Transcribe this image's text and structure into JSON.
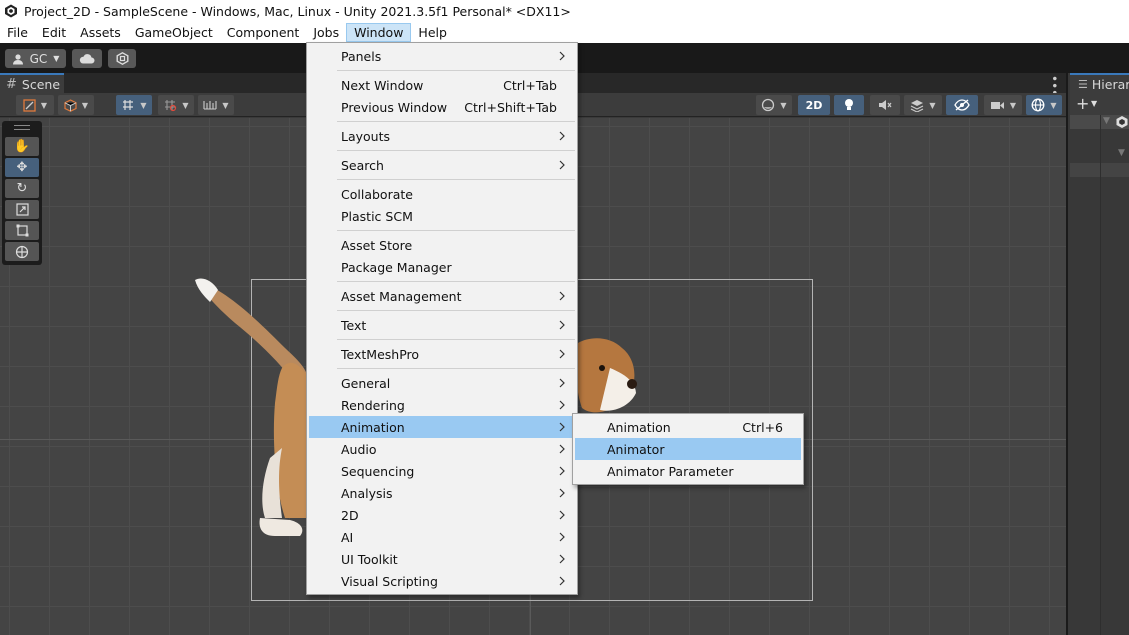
{
  "window": {
    "title": "Project_2D - SampleScene - Windows, Mac, Linux - Unity 2021.3.5f1 Personal* <DX11>"
  },
  "menubar": {
    "items": [
      "File",
      "Edit",
      "Assets",
      "GameObject",
      "Component",
      "Jobs",
      "Window",
      "Help"
    ],
    "active": "Window"
  },
  "toolbar": {
    "account_label": "GC"
  },
  "scene": {
    "tab_label": "Scene",
    "mode_2d_label": "2D"
  },
  "hierarchy": {
    "tab_label": "Hierarchy"
  },
  "window_menu": {
    "panels": "Panels",
    "next_window": "Next Window",
    "next_window_shortcut": "Ctrl+Tab",
    "previous_window": "Previous Window",
    "previous_window_shortcut": "Ctrl+Shift+Tab",
    "layouts": "Layouts",
    "search": "Search",
    "collaborate": "Collaborate",
    "plastic_scm": "Plastic SCM",
    "asset_store": "Asset Store",
    "package_manager": "Package Manager",
    "asset_management": "Asset Management",
    "text": "Text",
    "textmeshpro": "TextMeshPro",
    "general": "General",
    "rendering": "Rendering",
    "animation": "Animation",
    "audio": "Audio",
    "sequencing": "Sequencing",
    "analysis": "Analysis",
    "two_d": "2D",
    "ai": "AI",
    "ui_toolkit": "UI Toolkit",
    "visual_scripting": "Visual Scripting"
  },
  "animation_submenu": {
    "animation": "Animation",
    "animation_shortcut": "Ctrl+6",
    "animator": "Animator",
    "animator_parameter": "Animator Parameter"
  },
  "colors": {
    "menu_highlight": "#99c9f2",
    "menubar_active": "#cce4f7",
    "tool_selected": "#46607c"
  }
}
